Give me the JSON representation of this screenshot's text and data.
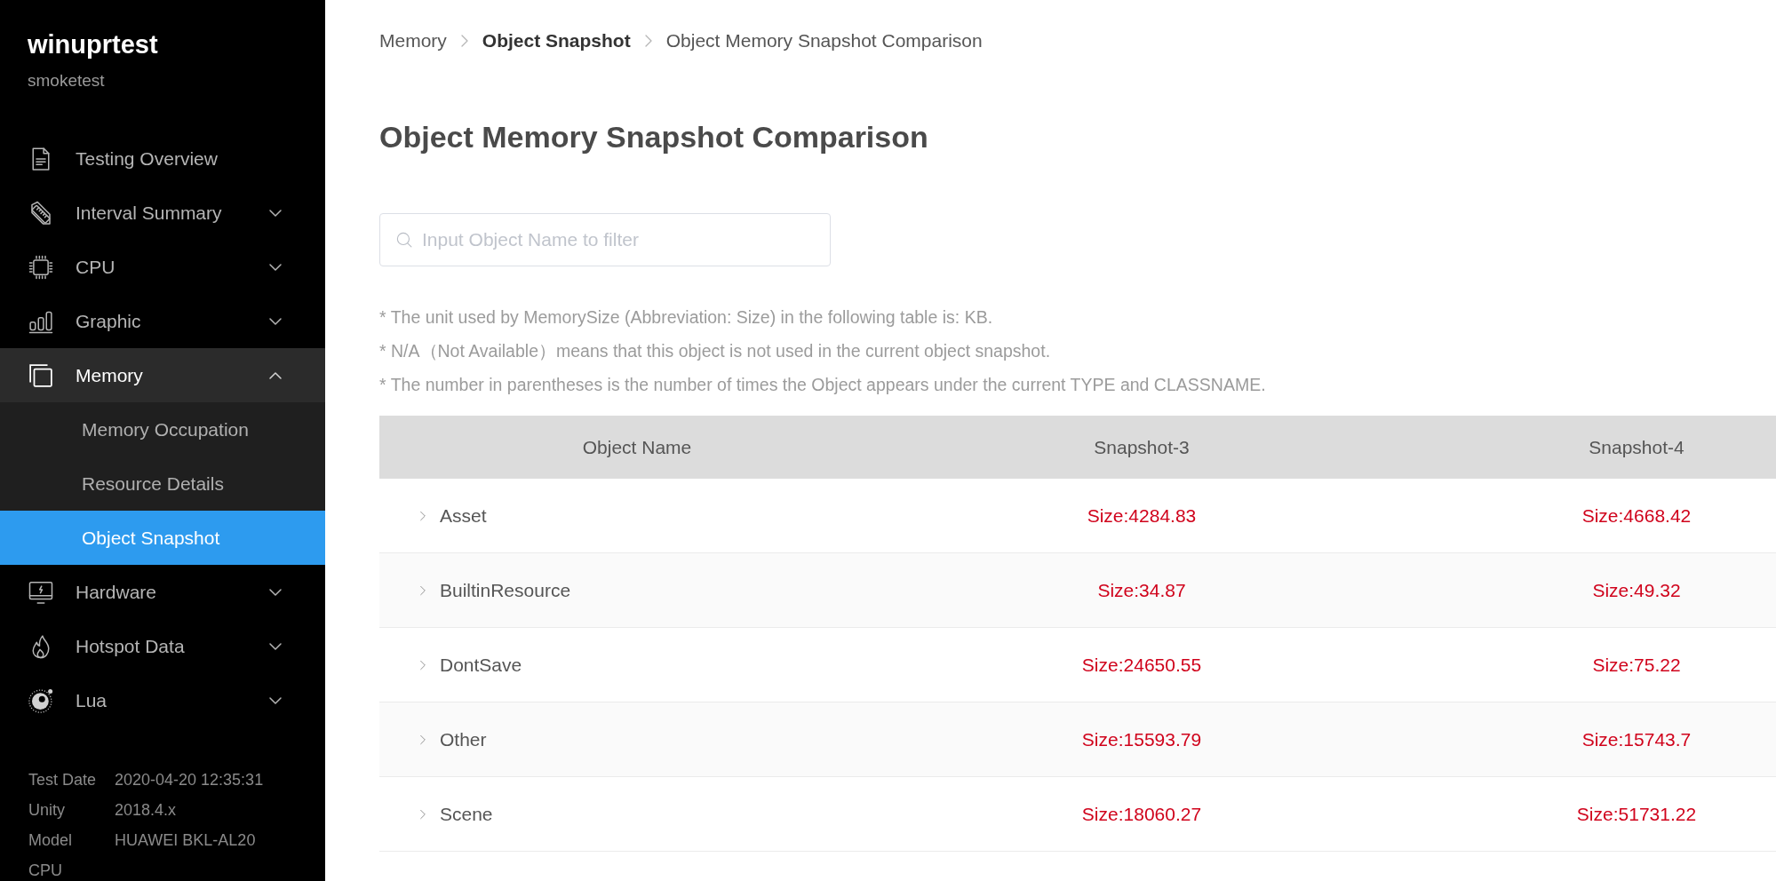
{
  "sidebar": {
    "title": "winuprtest",
    "subtitle": "smoketest",
    "items": [
      {
        "label": "Testing Overview",
        "kind": "link"
      },
      {
        "label": "Interval Summary",
        "kind": "group",
        "expanded": false
      },
      {
        "label": "CPU",
        "kind": "group",
        "expanded": false
      },
      {
        "label": "Graphic",
        "kind": "group",
        "expanded": false
      },
      {
        "label": "Memory",
        "kind": "group",
        "expanded": true,
        "children": [
          {
            "label": "Memory Occupation",
            "selected": false
          },
          {
            "label": "Resource Details",
            "selected": false
          },
          {
            "label": "Object Snapshot",
            "selected": true
          }
        ]
      },
      {
        "label": "Hardware",
        "kind": "group",
        "expanded": false
      },
      {
        "label": "Hotspot Data",
        "kind": "group",
        "expanded": false
      },
      {
        "label": "Lua",
        "kind": "group",
        "expanded": false
      }
    ],
    "info": [
      {
        "label": "Test Date",
        "value": "2020-04-20 12:35:31"
      },
      {
        "label": "Unity",
        "value": "2018.4.x"
      },
      {
        "label": "Model",
        "value": "HUAWEI BKL-AL20"
      },
      {
        "label": "CPU"
      }
    ]
  },
  "breadcrumb": [
    {
      "label": "Memory",
      "kind": "plain"
    },
    {
      "label": "Object Snapshot",
      "kind": "link"
    },
    {
      "label": "Object Memory Snapshot Comparison",
      "kind": "plain"
    }
  ],
  "title": "Object Memory Snapshot Comparison",
  "search": {
    "placeholder": "Input Object Name to filter"
  },
  "notes": [
    "* The unit used by MemorySize (Abbreviation: Size) in the following table is: KB.",
    "* N/A（Not Available）means that this object is not used in the current object snapshot.",
    "* The number in parentheses is the number of times the Object appears under the current TYPE and CLASSNAME."
  ],
  "table": {
    "columns": [
      "Object Name",
      "Snapshot-3",
      "Snapshot-4"
    ],
    "rows": [
      {
        "name": "Asset",
        "expanded": false,
        "values": [
          "Size:4284.83",
          "Size:4668.42"
        ]
      },
      {
        "name": "BuiltinResource",
        "expanded": false,
        "values": [
          "Size:34.87",
          "Size:49.32"
        ]
      },
      {
        "name": "DontSave",
        "expanded": false,
        "values": [
          "Size:24650.55",
          "Size:75.22"
        ]
      },
      {
        "name": "Other",
        "expanded": false,
        "values": [
          "Size:15593.79",
          "Size:15743.7"
        ]
      },
      {
        "name": "Scene",
        "expanded": false,
        "values": [
          "Size:18060.27",
          "Size:51731.22"
        ]
      }
    ]
  }
}
